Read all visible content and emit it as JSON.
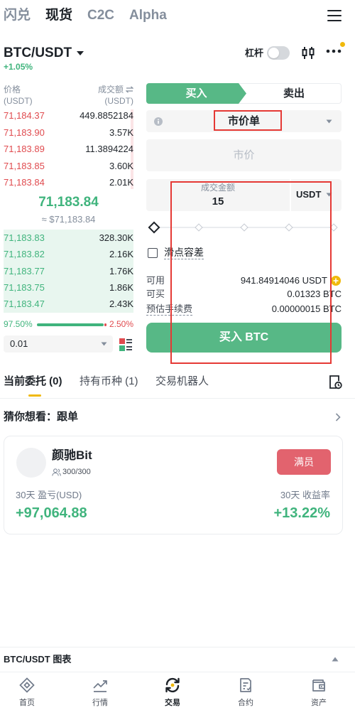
{
  "colors": {
    "buy_green": "#40b47d",
    "sell_red": "#e04b4f",
    "brand_yellow": "#f0b90b",
    "button_green": "#57b886",
    "full_badge_red": "#e2636e",
    "annotation_red": "#e53935"
  },
  "top_nav": {
    "tabs": [
      {
        "label": "闪兑",
        "active": false
      },
      {
        "label": "现货",
        "active": true
      },
      {
        "label": "C2C",
        "active": false
      },
      {
        "label": "Alpha",
        "active": false
      }
    ],
    "menu_icon": "hamburger-menu-icon"
  },
  "market_header": {
    "symbol": "BTC/USDT",
    "change": "+1.05%",
    "leverage_label": "杠杆",
    "leverage_enabled": false,
    "chart_icon": "candlestick-chart-icon",
    "more_icon": "more-dots-icon",
    "has_notification": true
  },
  "order_book": {
    "price_header": "价格",
    "price_unit": "(USDT)",
    "volume_header": "成交额",
    "volume_unit": "(USDT)",
    "asks": [
      {
        "price": "71,184.37",
        "volume": "449.8852184"
      },
      {
        "price": "71,183.90",
        "volume": "3.57K"
      },
      {
        "price": "71,183.89",
        "volume": "11.3894224"
      },
      {
        "price": "71,183.85",
        "volume": "3.60K"
      },
      {
        "price": "71,183.84",
        "volume": "2.01K"
      }
    ],
    "last_price": "71,183.84",
    "last_price_fiat": "≈ $71,183.84",
    "bids": [
      {
        "price": "71,183.83",
        "volume": "328.30K"
      },
      {
        "price": "71,183.82",
        "volume": "2.16K"
      },
      {
        "price": "71,183.77",
        "volume": "1.76K"
      },
      {
        "price": "71,183.75",
        "volume": "1.86K"
      },
      {
        "price": "71,183.47",
        "volume": "2.43K"
      }
    ],
    "buy_ratio_label": "97.50%",
    "sell_ratio_label": "2.50%",
    "buy_ratio": 97.5,
    "precision": "0.01",
    "depth_view_icon": "depth-layout-icon"
  },
  "order_form": {
    "buy_tab": "买入",
    "sell_tab": "卖出",
    "active_side": "buy",
    "order_type": "市价单",
    "price_placeholder": "市价",
    "amount_label": "成交金额",
    "amount_value": "15",
    "amount_unit": "USDT",
    "slider_percent": 0,
    "slippage_label": "滑点容差",
    "slippage_checked": false,
    "available_label": "可用",
    "available_value": "941.84914046 USDT",
    "max_buy_label": "可买",
    "max_buy_value": "0.01323 BTC",
    "fee_label": "预估手续费",
    "fee_value": "0.00000015 BTC",
    "submit_label": "买入 BTC"
  },
  "orders_tabs": [
    {
      "label": "当前委托 (0)",
      "active": true
    },
    {
      "label": "持有币种 (1)",
      "active": false
    },
    {
      "label": "交易机器人",
      "active": false
    }
  ],
  "suggest": {
    "title": "猜你想看：跟单"
  },
  "copy_trader": {
    "name": "颜驰Bit",
    "followers": "300/300",
    "status_button": "满员",
    "pnl_label": "30天 盈亏(USD)",
    "pnl_value": "+97,064.88",
    "roi_label": "30天 收益率",
    "roi_value": "+13.22%"
  },
  "chart_bar": {
    "label": "BTC/USDT 图表"
  },
  "bottom_nav": [
    {
      "label": "首页",
      "icon": "home-diamond-icon",
      "active": false
    },
    {
      "label": "行情",
      "icon": "market-chart-icon",
      "active": false
    },
    {
      "label": "交易",
      "icon": "trade-swap-icon",
      "active": true
    },
    {
      "label": "合约",
      "icon": "futures-contract-icon",
      "active": false
    },
    {
      "label": "资产",
      "icon": "assets-wallet-icon",
      "active": false
    }
  ]
}
